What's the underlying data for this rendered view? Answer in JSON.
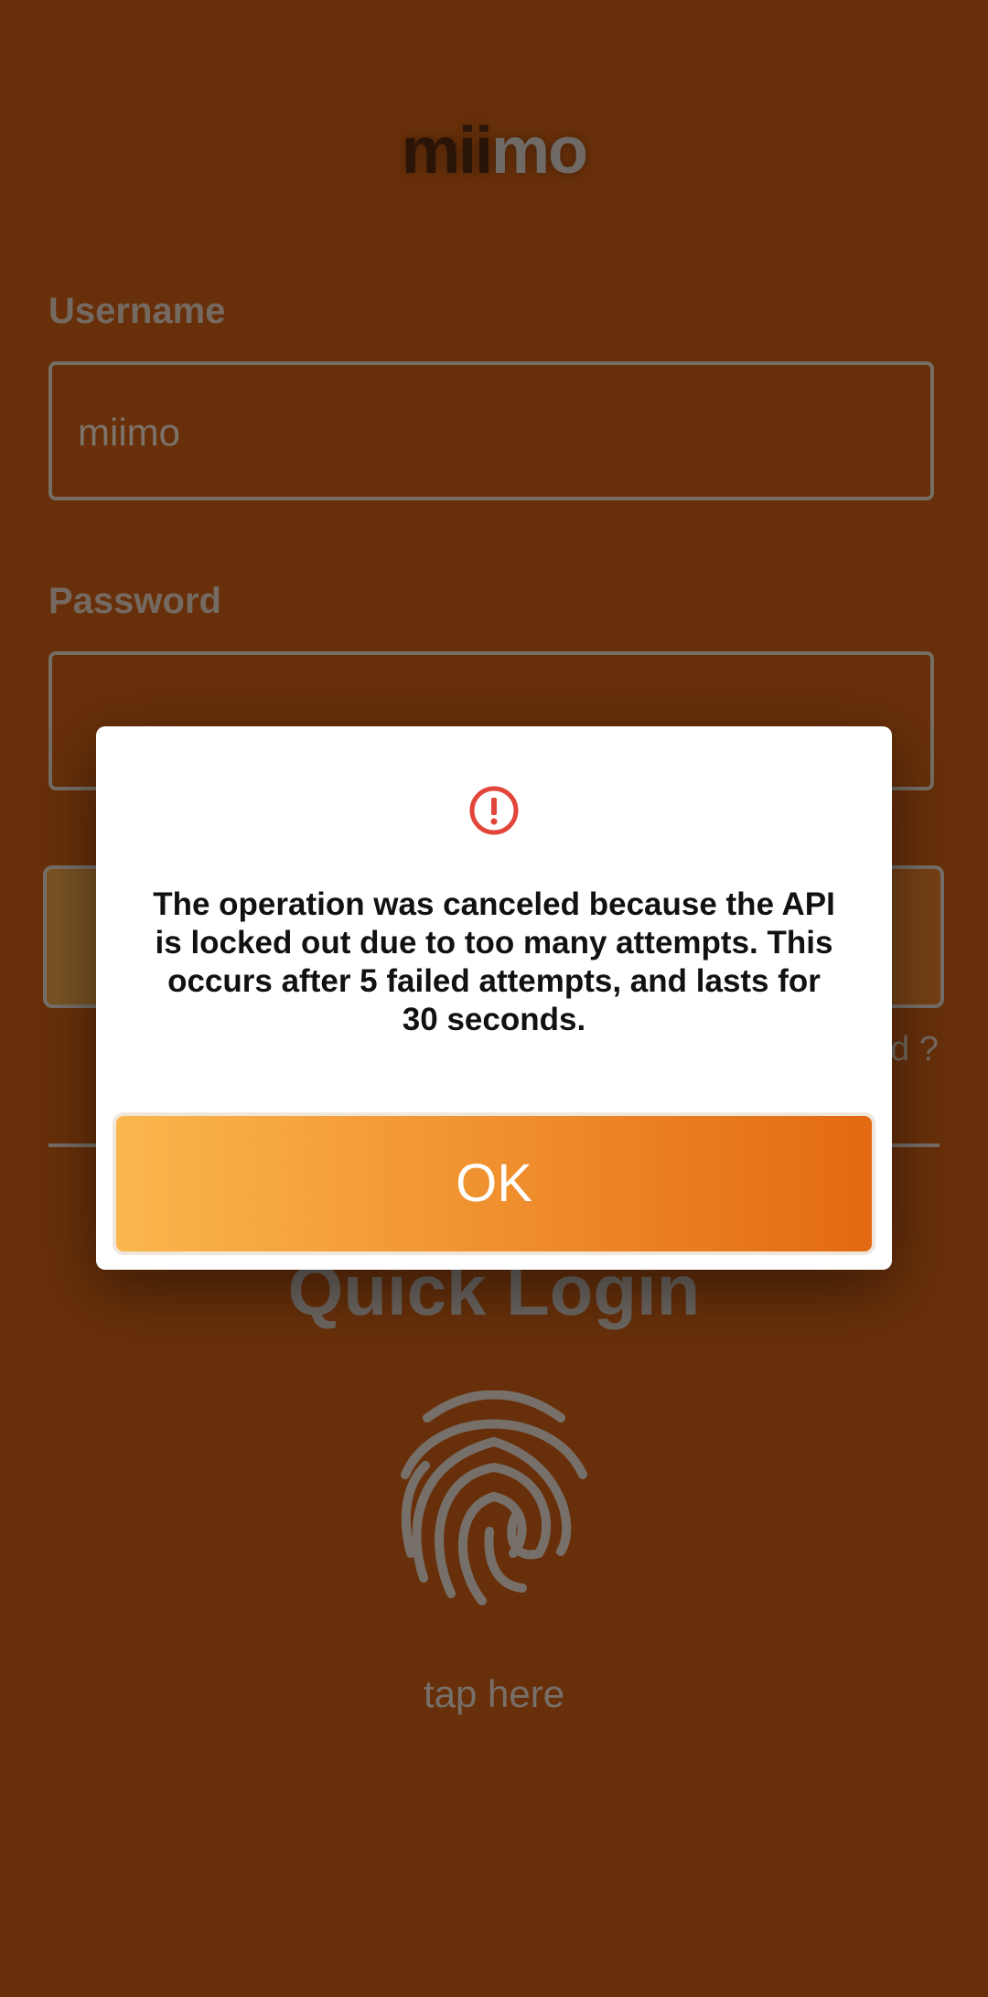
{
  "app": {
    "logo_dark": "mii",
    "logo_light": "mo"
  },
  "form": {
    "username_label": "Username",
    "username_value": "miimo",
    "password_label": "Password",
    "password_value": "",
    "forgot_label_visible": "rd ?"
  },
  "quick_login": {
    "title": "Quick Login",
    "tap_label": "tap here",
    "icon": "fingerprint-icon"
  },
  "dialog": {
    "icon": "alert-circle-icon",
    "message": "The operation was canceled because the API is locked out due to too many attempts. This occurs after 5 failed attempts, and lasts for 30 seconds.",
    "ok_label": "OK"
  },
  "colors": {
    "background": "#68300a",
    "dialog_background": "#ffffff",
    "alert_red": "#e2453a",
    "button_gradient_start": "#fbb64e",
    "button_gradient_end": "#e36912"
  }
}
